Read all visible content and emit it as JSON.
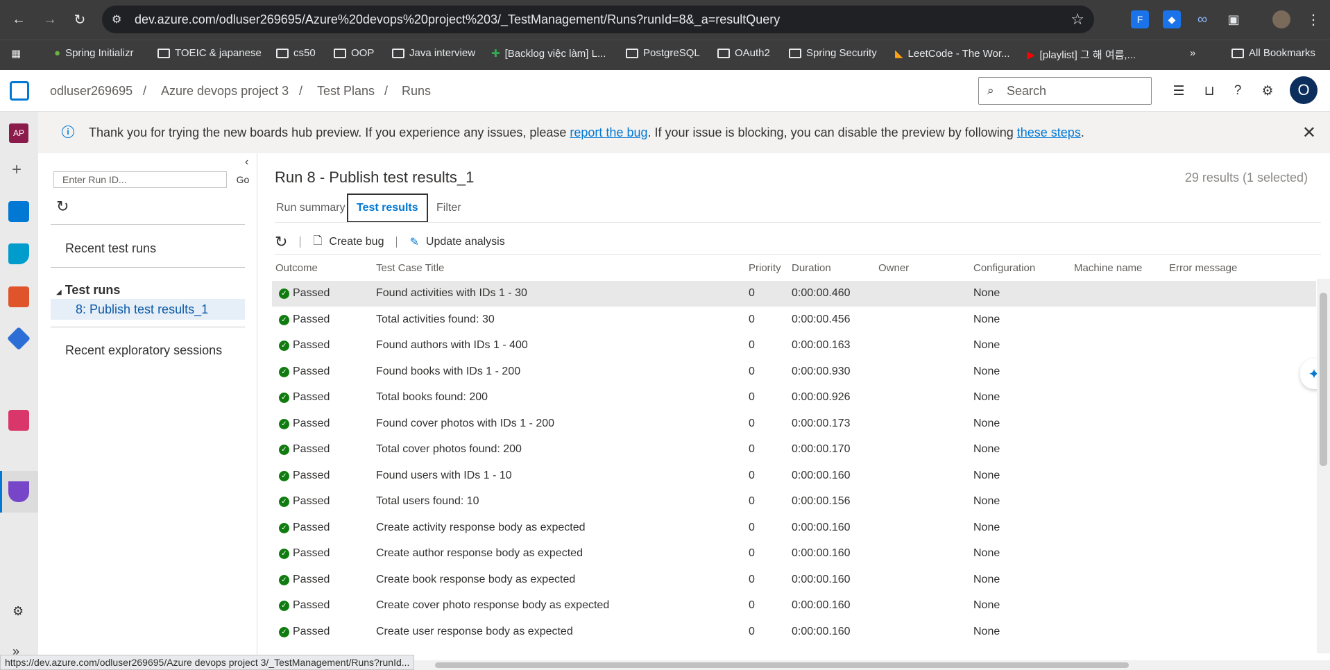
{
  "browser": {
    "url": "dev.azure.com/odluser269695/Azure%20devops%20project%203/_TestManagement/Runs?runId=8&_a=resultQuery",
    "bookmarks": [
      "Spring Initializr",
      "TOEIC & japanese",
      "cs50",
      "OOP",
      "Java interview",
      "[Backlog việc làm] L...",
      "PostgreSQL",
      "OAuth2",
      "Spring Security",
      "LeetCode - The Wor...",
      "[playlist] 그 해 여름,...",
      "All Bookmarks"
    ],
    "status_url": "https://dev.azure.com/odluser269695/Azure devops project 3/_TestManagement/Runs?runId..."
  },
  "header": {
    "breadcrumbs": [
      "odluser269695",
      "Azure devops project 3",
      "Test Plans",
      "Runs"
    ],
    "search_placeholder": "Search",
    "avatar_initial": "O",
    "rail_project_initials": "AP"
  },
  "banner": {
    "text_before": "Thank you for trying the new boards hub preview. If you experience any issues, please ",
    "link1": "report the bug",
    "text_middle": ". If your issue is blocking, you can disable the preview by following ",
    "link2": "these steps",
    "text_after": "."
  },
  "left_pane": {
    "run_id_placeholder": "Enter Run ID...",
    "go_label": "Go",
    "recent_test_runs": "Recent test runs",
    "test_runs_group": "Test runs",
    "selected_run": "8: Publish test results_1",
    "recent_exploratory": "Recent exploratory sessions"
  },
  "main": {
    "title": "Run 8 - Publish test results_1",
    "results_count": "29 results (1 selected)",
    "tabs": [
      "Run summary",
      "Test results",
      "Filter"
    ],
    "toolbar": {
      "create_bug": "Create bug",
      "update_analysis": "Update analysis"
    },
    "columns": [
      "Outcome",
      "Test Case Title",
      "Priority",
      "Duration",
      "Owner",
      "Configuration",
      "Machine name",
      "Error message"
    ],
    "rows": [
      {
        "outcome": "Passed",
        "title": "Found activities with IDs 1 - 30",
        "priority": "0",
        "duration": "0:00:00.460",
        "owner": "",
        "configuration": "None"
      },
      {
        "outcome": "Passed",
        "title": "Total activities found: 30",
        "priority": "0",
        "duration": "0:00:00.456",
        "owner": "",
        "configuration": "None"
      },
      {
        "outcome": "Passed",
        "title": "Found authors with IDs 1 - 400",
        "priority": "0",
        "duration": "0:00:00.163",
        "owner": "",
        "configuration": "None"
      },
      {
        "outcome": "Passed",
        "title": "Found books with IDs 1 - 200",
        "priority": "0",
        "duration": "0:00:00.930",
        "owner": "",
        "configuration": "None"
      },
      {
        "outcome": "Passed",
        "title": "Total books found: 200",
        "priority": "0",
        "duration": "0:00:00.926",
        "owner": "",
        "configuration": "None"
      },
      {
        "outcome": "Passed",
        "title": "Found cover photos with IDs 1 - 200",
        "priority": "0",
        "duration": "0:00:00.173",
        "owner": "",
        "configuration": "None"
      },
      {
        "outcome": "Passed",
        "title": "Total cover photos found: 200",
        "priority": "0",
        "duration": "0:00:00.170",
        "owner": "",
        "configuration": "None"
      },
      {
        "outcome": "Passed",
        "title": "Found users with IDs 1 - 10",
        "priority": "0",
        "duration": "0:00:00.160",
        "owner": "",
        "configuration": "None"
      },
      {
        "outcome": "Passed",
        "title": "Total users found: 10",
        "priority": "0",
        "duration": "0:00:00.156",
        "owner": "",
        "configuration": "None"
      },
      {
        "outcome": "Passed",
        "title": "Create activity response body as expected",
        "priority": "0",
        "duration": "0:00:00.160",
        "owner": "",
        "configuration": "None"
      },
      {
        "outcome": "Passed",
        "title": "Create author response body as expected",
        "priority": "0",
        "duration": "0:00:00.160",
        "owner": "",
        "configuration": "None"
      },
      {
        "outcome": "Passed",
        "title": "Create book response body as expected",
        "priority": "0",
        "duration": "0:00:00.160",
        "owner": "",
        "configuration": "None"
      },
      {
        "outcome": "Passed",
        "title": "Create cover photo response body as expected",
        "priority": "0",
        "duration": "0:00:00.160",
        "owner": "",
        "configuration": "None"
      },
      {
        "outcome": "Passed",
        "title": "Create user response body as expected",
        "priority": "0",
        "duration": "0:00:00.160",
        "owner": "",
        "configuration": "None"
      }
    ]
  },
  "colors": {
    "accent": "#0078d4",
    "passed": "#107c10",
    "chrome": "#3c3c3c"
  }
}
